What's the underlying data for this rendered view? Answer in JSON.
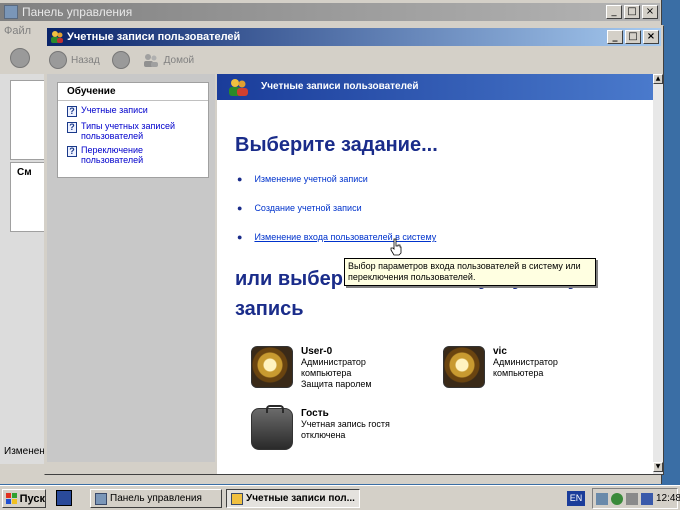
{
  "back_window": {
    "title": "Панель управления",
    "menu_first": "Файл",
    "left_panel_header": "См",
    "status_text": "Изменен",
    "controls": {
      "minimize": "_",
      "maximize": "□",
      "close": "×"
    }
  },
  "window": {
    "title": "Учетные записи пользователей",
    "controls": {
      "minimize": "_",
      "maximize": "□",
      "close": "×"
    },
    "toolbar": {
      "back": "Назад",
      "home": "Домой"
    }
  },
  "learn": {
    "header": "Обучение",
    "items": [
      {
        "label": "Учетные записи"
      },
      {
        "label": "Типы учетных записей пользователей"
      },
      {
        "label": "Переключение пользователей"
      }
    ]
  },
  "main": {
    "banner": "Учетные записи пользователей",
    "pick_task": "Выберите задание...",
    "tasks": [
      {
        "label": "Изменение учетной записи"
      },
      {
        "label": "Создание учетной записи"
      },
      {
        "label": "Изменение входа пользователей в систему"
      }
    ],
    "or_pick": "или выберите изменяемую учетную запись",
    "tooltip": "Выбор параметров входа пользователей в систему или переключения пользователей.",
    "accounts": [
      {
        "name": "User-0",
        "lines": [
          "Администратор",
          "компьютера",
          "Защита паролем"
        ]
      },
      {
        "name": "vic",
        "lines": [
          "Администратор",
          "компьютера"
        ]
      },
      {
        "name": "Гость",
        "lines": [
          "Учетная запись гостя",
          "отключена"
        ]
      }
    ]
  },
  "taskbar": {
    "start": "Пуск",
    "buttons": [
      {
        "label": "Панель управления"
      },
      {
        "label": "Учетные записи пол..."
      }
    ],
    "lang": "EN",
    "clock": "12:48"
  },
  "colors": {
    "accent": "#0a246a",
    "link": "#0033cc",
    "heading": "#1a2c8a"
  }
}
